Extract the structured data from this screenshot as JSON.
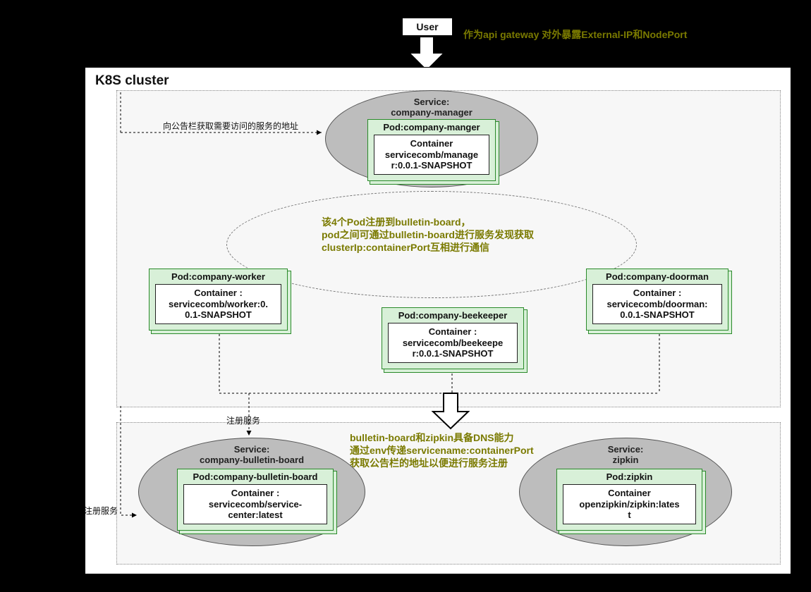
{
  "user": {
    "label": "User"
  },
  "annotations": {
    "gateway": "作为api gateway 对外暴露External-IP和NodePort",
    "middle1": "该4个Pod注册到bulletin-board，",
    "middle2": "pod之间可通过bulletin-board进行服务发现获取",
    "middle3": "clusterIp:containerPort互相进行通信",
    "bottom1": "bulletin-board和zipkin具备DNS能力",
    "bottom2": "通过env传递servicename:containerPort",
    "bottom3": "获取公告栏的地址以便进行服务注册"
  },
  "cluster": {
    "title": "K8S cluster"
  },
  "labels": {
    "fetchAddr": "向公告栏获取需要访问的服务的地址",
    "register1": "注册服务",
    "register2": "注册服务"
  },
  "services": {
    "manager": {
      "title1": "Service:",
      "title2": "company-manager",
      "podTitle": "Pod:company-manger",
      "container1": "Container",
      "container2": "servicecomb/manage",
      "container3": "r:0.0.1-SNAPSHOT"
    },
    "bulletin": {
      "title1": "Service:",
      "title2": "company-bulletin-board",
      "podTitle": "Pod:company-bulletin-board",
      "container1": "Container :",
      "container2": "servicecomb/service-",
      "container3": "center:latest"
    },
    "zipkin": {
      "title1": "Service:",
      "title2": "zipkin",
      "podTitle": "Pod:zipkin",
      "container1": "Container",
      "container2": "openzipkin/zipkin:lates",
      "container3": "t"
    }
  },
  "pods": {
    "worker": {
      "title": "Pod:company-worker",
      "container1": "Container :",
      "container2": "servicecomb/worker:0.",
      "container3": "0.1-SNAPSHOT"
    },
    "beekeeper": {
      "title": "Pod:company-beekeeper",
      "container1": "Container :",
      "container2": "servicecomb/beekeepe",
      "container3": "r:0.0.1-SNAPSHOT"
    },
    "doorman": {
      "title": "Pod:company-doorman",
      "container1": "Container :",
      "container2": "servicecomb/doorman:",
      "container3": "0.0.1-SNAPSHOT"
    }
  }
}
